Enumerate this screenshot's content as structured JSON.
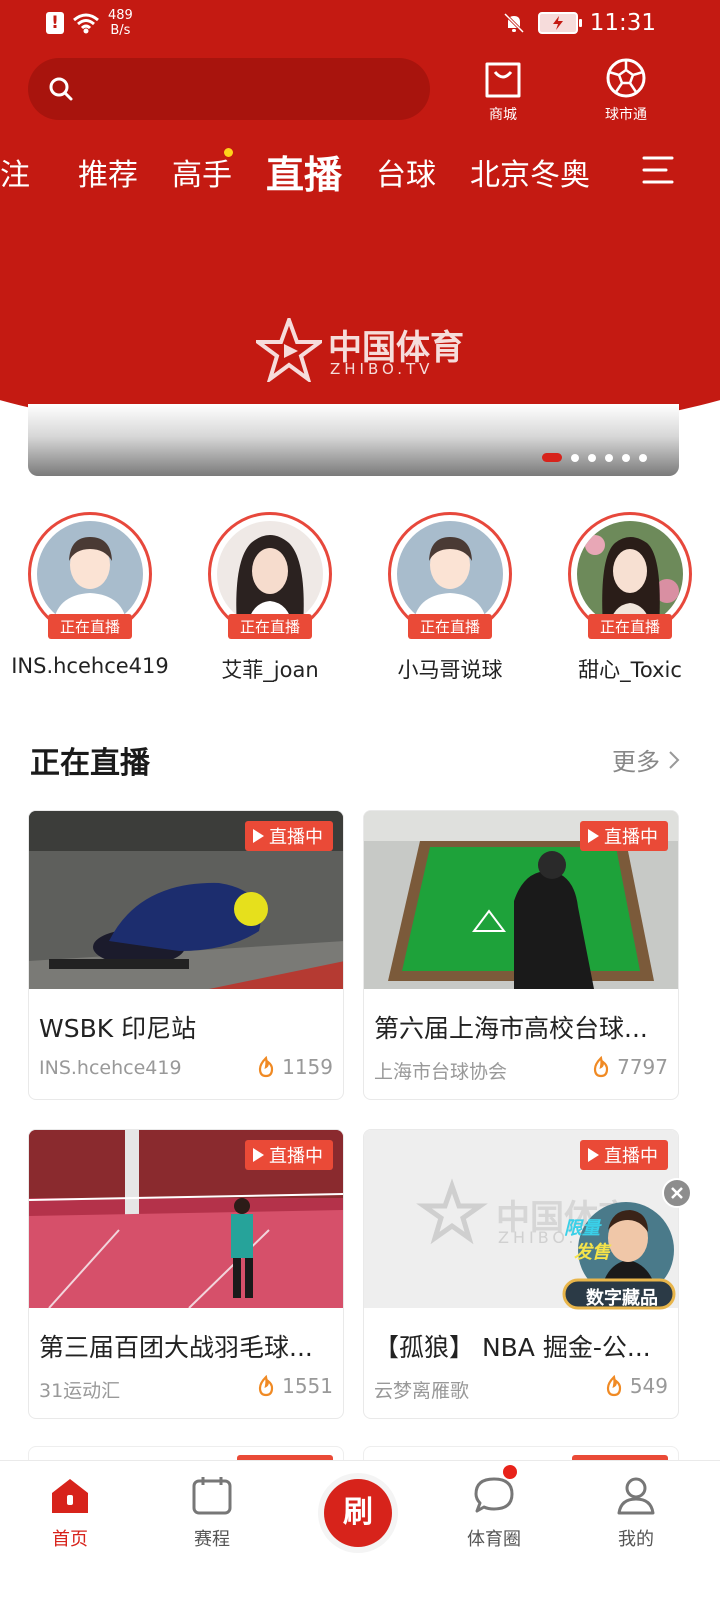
{
  "status_bar": {
    "speed_value": "489",
    "speed_unit": "B/s",
    "time": "11:31"
  },
  "header": {
    "search_placeholder": "",
    "actions": [
      {
        "label": "商城",
        "icon": "shopping-bag-icon"
      },
      {
        "label": "球市通",
        "icon": "football-icon"
      }
    ]
  },
  "tabs": [
    {
      "label": "关注",
      "active": false
    },
    {
      "label": "推荐",
      "active": false
    },
    {
      "label": "高手",
      "active": false,
      "has_dot": true
    },
    {
      "label": "直播",
      "active": true
    },
    {
      "label": "台球",
      "active": false
    },
    {
      "label": "北京冬奥",
      "active": false
    }
  ],
  "banner": {
    "logo_cn": "中国体育",
    "logo_en": "ZHIBO.TV",
    "page_count": 6,
    "active_index": 0
  },
  "live_streamers": {
    "badge": "正在直播",
    "items": [
      {
        "name": "INS.hcehce419"
      },
      {
        "name": "艾菲_joan"
      },
      {
        "name": "小马哥说球"
      },
      {
        "name": "甜心_Toxic"
      }
    ]
  },
  "live_section": {
    "title": "正在直播",
    "more": "更多",
    "live_tag": "直播中",
    "cards": [
      {
        "title": "WSBK 印尼站",
        "author": "INS.hcehce419",
        "heat": "1159"
      },
      {
        "title": "第六届上海市高校台球...",
        "author": "上海市台球协会",
        "heat": "7797"
      },
      {
        "title": "第三届百团大战羽毛球...",
        "author": "31运动汇",
        "heat": "1551"
      },
      {
        "title": "【孤狼】 NBA 掘金-公...",
        "author": "云梦离雁歌",
        "heat": "549"
      }
    ]
  },
  "promo": {
    "line1": "限量",
    "line2": "发售",
    "line3": "数字藏品"
  },
  "bottom_nav": {
    "center_label": "刷",
    "items": [
      {
        "label": "首页",
        "active": true
      },
      {
        "label": "赛程",
        "active": false
      },
      {
        "label": "体育圈",
        "active": false
      },
      {
        "label": "我的",
        "active": false
      }
    ]
  },
  "colors": {
    "brand_red": "#c41a12",
    "live_red": "#ea4a37",
    "tab_dot": "#ffd21a"
  }
}
